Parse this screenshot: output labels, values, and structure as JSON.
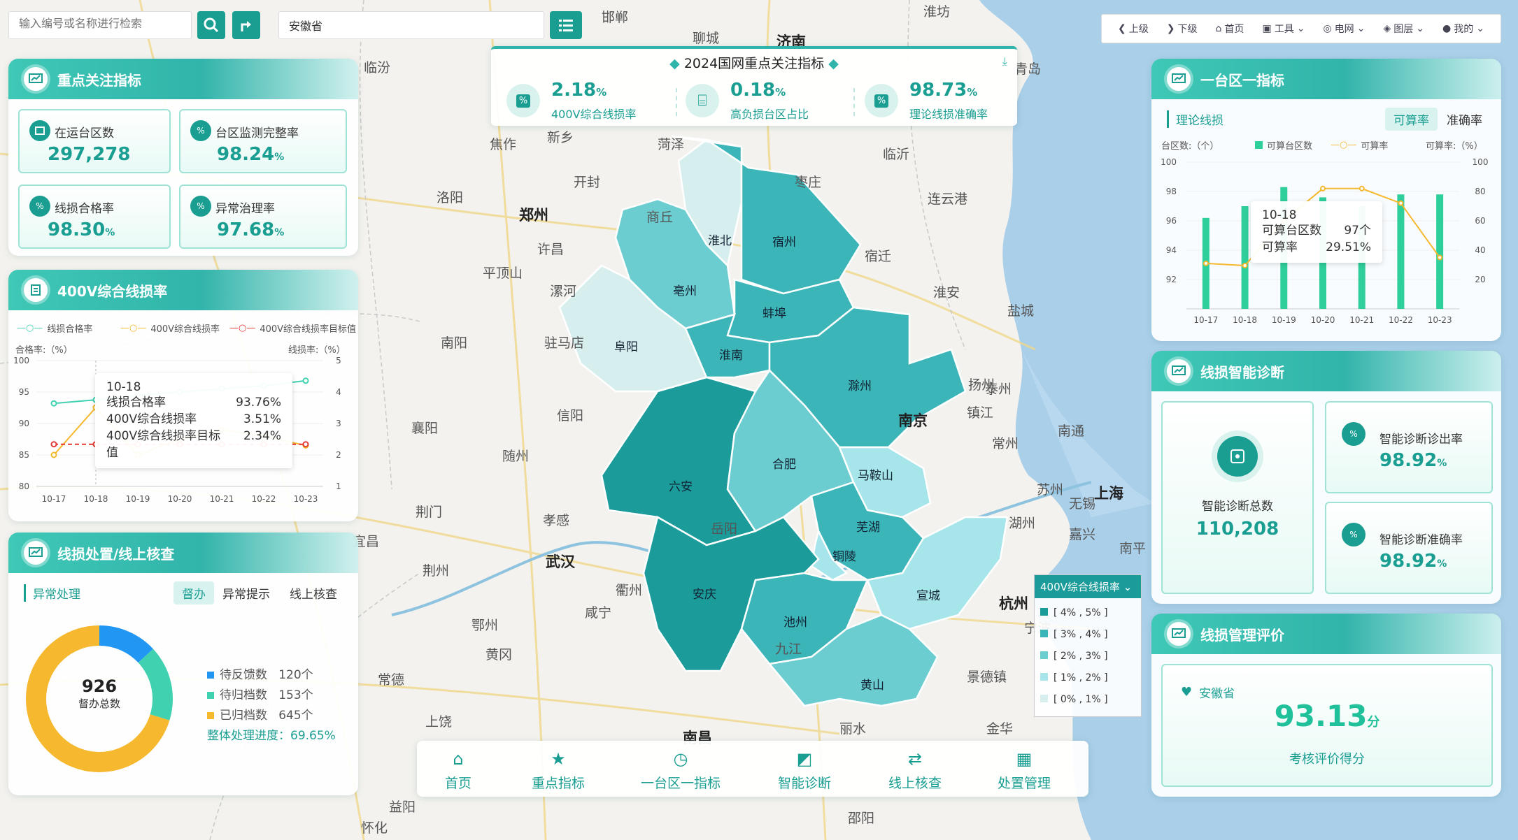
{
  "search": {
    "placeholder": "输入编号或名称进行检索",
    "region_value": "安徽省"
  },
  "toolbar": {
    "items": [
      {
        "label": "上级",
        "icon": "arrow-left-icon"
      },
      {
        "label": "下级",
        "icon": "arrow-right-icon"
      },
      {
        "label": "首页",
        "icon": "home-icon"
      },
      {
        "label": "工具",
        "icon": "toolbox-icon"
      },
      {
        "label": "电网",
        "icon": "globe-icon"
      },
      {
        "label": "图层",
        "icon": "layers-icon"
      },
      {
        "label": "我的",
        "icon": "user-icon"
      }
    ]
  },
  "key_banner": {
    "title": "2024国网重点关注指标",
    "items": [
      {
        "value": "2.18",
        "unit": "%",
        "label": "400V综合线损率"
      },
      {
        "value": "0.18",
        "unit": "%",
        "label": "高负损台区占比"
      },
      {
        "value": "98.73",
        "unit": "%",
        "label": "理论线损准确率"
      }
    ]
  },
  "key_indicators": {
    "title": "重点关注指标",
    "cards": [
      {
        "label": "在运台区数",
        "value": "297,278",
        "unit": ""
      },
      {
        "label": "台区监测完整率",
        "value": "98.24",
        "unit": "%"
      },
      {
        "label": "线损合格率",
        "value": "98.30",
        "unit": "%"
      },
      {
        "label": "异常治理率",
        "value": "97.68",
        "unit": "%"
      }
    ]
  },
  "loss_400v": {
    "title": "400V综合线损率",
    "legend": [
      "线损合格率",
      "400V综合线损率",
      "400V综合线损率目标值"
    ],
    "left_axis_title": "合格率:（%）",
    "right_axis_title": "线损率:（%）",
    "tooltip": {
      "date": "10-18",
      "rows": [
        {
          "k": "线损合格率",
          "v": "93.76%"
        },
        {
          "k": "400V综合线损率",
          "v": "3.51%"
        },
        {
          "k": "400V综合线损率目标值",
          "v": "2.34%"
        }
      ]
    }
  },
  "disposal": {
    "title": "线损处置/线上核查",
    "subtitle": "异常处理",
    "tabs": [
      "督办",
      "异常提示",
      "线上核查"
    ],
    "center_value": "926",
    "center_label": "督办总数",
    "legend": [
      {
        "label": "待反馈数",
        "value": "120个",
        "color": "#2196f3"
      },
      {
        "label": "待归档数",
        "value": "153个",
        "color": "#3fd1b0"
      },
      {
        "label": "已归档数",
        "value": "645个",
        "color": "#f5b82e"
      }
    ],
    "progress_label": "整体处理进度：69.65%"
  },
  "tq_indicator": {
    "title": "一台区一指标",
    "subtitle": "理论线损",
    "tabs": [
      "可算率",
      "准确率"
    ],
    "left_axis_title": "台区数:（个）",
    "right_axis_title": "可算率:（%）",
    "legend": [
      "可算台区数",
      "可算率"
    ],
    "tooltip": {
      "date": "10-18",
      "rows": [
        {
          "k": "可算台区数",
          "v": "97个"
        },
        {
          "k": "可算率",
          "v": "29.51%"
        }
      ]
    }
  },
  "diagnosis": {
    "title": "线损智能诊断",
    "total_label": "智能诊断总数",
    "total_value": "110,208",
    "cards": [
      {
        "label": "智能诊断诊出率",
        "value": "98.92",
        "unit": "%"
      },
      {
        "label": "智能诊断准确率",
        "value": "98.92",
        "unit": "%"
      }
    ]
  },
  "evaluation": {
    "title": "线损管理评价",
    "region": "安徽省",
    "score": "93.13",
    "unit": "分",
    "label": "考核评价得分"
  },
  "map_legend": {
    "title": "400V综合线损率",
    "items": [
      {
        "label": "[ 4% , 5% ]",
        "color": "#1b9c9a"
      },
      {
        "label": "[ 3% , 4% ]",
        "color": "#3bb5b8"
      },
      {
        "label": "[ 2% , 3% ]",
        "color": "#6ccdd0"
      },
      {
        "label": "[ 1% , 2% ]",
        "color": "#a6e6ea"
      },
      {
        "label": "[ 0% , 1% ]",
        "color": "#d7eeee"
      }
    ]
  },
  "bottom_nav": [
    {
      "label": "首页",
      "icon": "home-icon"
    },
    {
      "label": "重点指标",
      "icon": "star-doc-icon"
    },
    {
      "label": "一台区一指标",
      "icon": "clock-icon"
    },
    {
      "label": "智能诊断",
      "icon": "chart-icon"
    },
    {
      "label": "线上核查",
      "icon": "exchange-icon"
    },
    {
      "label": "处置管理",
      "icon": "calendar-icon"
    }
  ],
  "map": {
    "provinces": [
      "淮北",
      "宿州",
      "亳州",
      "蚌埠",
      "阜阳",
      "淮南",
      "滁州",
      "六安",
      "合肥",
      "南京",
      "马鞍山",
      "芜湖",
      "铜陵",
      "安庆",
      "池州",
      "宣城",
      "黄山"
    ],
    "cities_major": [
      "郑州",
      "武汉",
      "南京",
      "上海",
      "杭州",
      "南昌",
      "济南"
    ],
    "cities_minor": [
      "邯郸",
      "聊城",
      "临汾",
      "淮坊",
      "青岛",
      "菏泽",
      "焦作",
      "新乡",
      "开封",
      "枣庄",
      "临沂",
      "洛阳",
      "商丘",
      "连云港",
      "宿迁",
      "许昌",
      "平顶山",
      "漯河",
      "盐城",
      "淮安",
      "南阳",
      "驻马店",
      "泰州",
      "扬州",
      "镇江",
      "南通",
      "信阳",
      "襄阳",
      "随州",
      "常州",
      "苏州",
      "无锡",
      "湖州",
      "嘉兴",
      "荆门",
      "孝感",
      "荆州",
      "宜昌",
      "咸宁",
      "黄冈",
      "岳阳",
      "常德",
      "九江",
      "景德镇",
      "金华",
      "丽水",
      "上饶",
      "益阳",
      "怀化",
      "邵阳",
      "南平",
      "宁波",
      "衢州",
      "鄂州",
      "岳阳"
    ]
  },
  "colors": {
    "accent": "#1a9e92",
    "header": "#31b4aa",
    "bar": "#2ecf9a",
    "line_orange": "#f5b82e",
    "line_red": "#e53935"
  },
  "chart_data": [
    {
      "type": "line",
      "title": "400V综合线损率",
      "x": [
        "10-17",
        "10-18",
        "10-19",
        "10-20",
        "10-21",
        "10-22",
        "10-23"
      ],
      "series": [
        {
          "name": "线损合格率",
          "axis": "left",
          "values": [
            93.2,
            93.76,
            94.5,
            95.0,
            95.5,
            96.0,
            96.8
          ]
        },
        {
          "name": "400V综合线损率",
          "axis": "right",
          "values": [
            2.0,
            3.51,
            2.0,
            2.5,
            2.8,
            2.6,
            2.3
          ]
        },
        {
          "name": "400V综合线损率目标值",
          "axis": "right",
          "values": [
            2.34,
            2.34,
            2.34,
            2.34,
            2.34,
            2.34,
            2.34
          ]
        }
      ],
      "ylim_left": [
        80,
        100
      ],
      "yticks_left": [
        80,
        85,
        90,
        95,
        100
      ],
      "ylim_right": [
        1,
        5
      ],
      "yticks_right": [
        1,
        2,
        3,
        4,
        5
      ]
    },
    {
      "type": "bar",
      "title": "一台区一指标",
      "categories": [
        "10-17",
        "10-18",
        "10-19",
        "10-20",
        "10-21",
        "10-22",
        "10-23"
      ],
      "series": [
        {
          "name": "可算台区数",
          "type": "bar",
          "axis": "left",
          "values": [
            96.2,
            97,
            98.3,
            97.6,
            97.0,
            97.8,
            97.8
          ]
        },
        {
          "name": "可算率",
          "type": "line",
          "axis": "right",
          "values": [
            31,
            29.51,
            60,
            82,
            82,
            72,
            35
          ]
        }
      ],
      "ylim_left": [
        90,
        100
      ],
      "yticks_left": [
        92,
        94,
        96,
        98,
        100
      ],
      "ylim_right": [
        0,
        100
      ],
      "yticks_right": [
        20,
        40,
        60,
        80,
        100
      ]
    },
    {
      "type": "pie",
      "title": "督办总数",
      "labels": [
        "待反馈数",
        "待归档数",
        "已归档数"
      ],
      "values": [
        120,
        153,
        645
      ]
    }
  ]
}
